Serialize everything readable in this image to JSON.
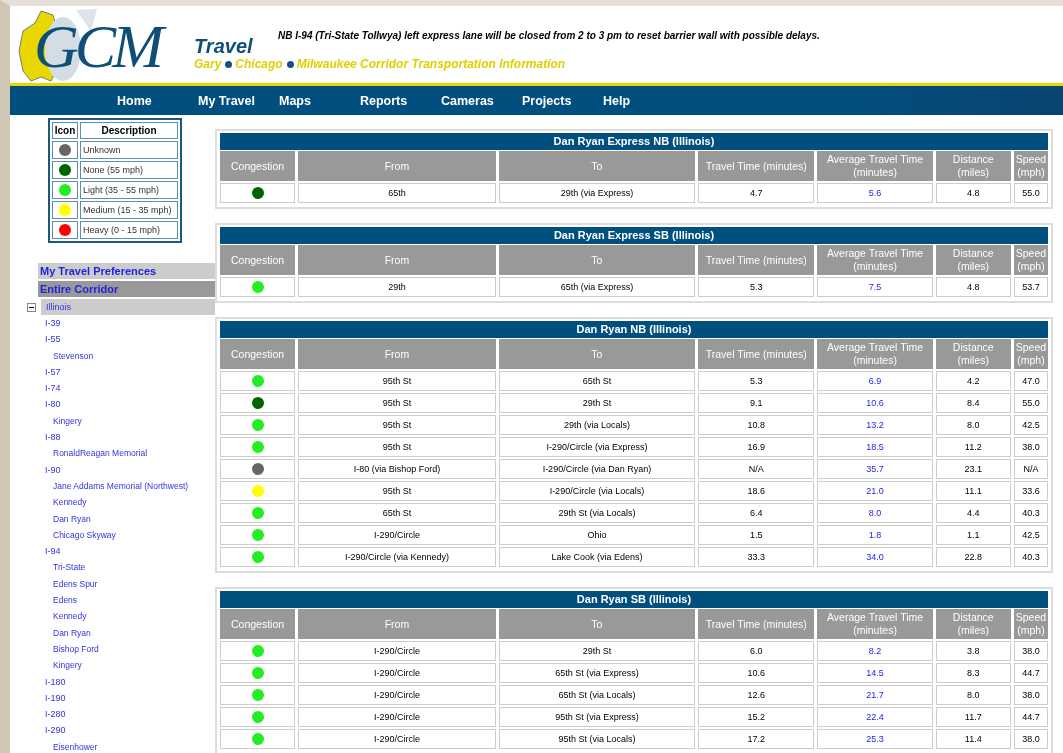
{
  "header": {
    "logo_text": "GCM",
    "brand": "Travel",
    "tagline": [
      "Gary",
      "Chicago",
      "Milwaukee Corridor Transportation Information"
    ],
    "alert": "NB I-94 (Tri-State Tollwya) left express lane will be closed from 2 to 3 pm to reset barrier wall with possible delays."
  },
  "nav": [
    "Home",
    "My Travel",
    "Maps",
    "Reports",
    "Cameras",
    "Projects",
    "Help"
  ],
  "legend": {
    "columns": [
      "Icon",
      "Description"
    ],
    "items": [
      {
        "color": "#666666",
        "label": "Unknown"
      },
      {
        "color": "#006400",
        "label": "None (55 mph)"
      },
      {
        "color": "#22ee22",
        "label": "Light (35 - 55 mph)"
      },
      {
        "color": "#ffff00",
        "label": "Medium (15 - 35 mph)"
      },
      {
        "color": "#ff0000",
        "label": "Heavy (0 - 15 mph)"
      }
    ]
  },
  "menu": [
    {
      "label": "My Travel Preferences",
      "selected": false
    },
    {
      "label": "Entire Corridor",
      "selected": true
    }
  ],
  "tree": [
    {
      "label": "Illinois",
      "expanded": true,
      "selected": true,
      "children": [
        {
          "label": "I-39",
          "selected": false
        },
        {
          "label": "I-55",
          "selected": false,
          "children": [
            {
              "label": "Stevenson",
              "selected": false
            }
          ]
        },
        {
          "label": "I-57",
          "selected": false
        },
        {
          "label": "I-74",
          "selected": false
        },
        {
          "label": "I-80",
          "selected": false,
          "children": [
            {
              "label": "Kingery",
              "selected": false
            }
          ]
        },
        {
          "label": "I-88",
          "selected": false,
          "children": [
            {
              "label": "RonaldReagan Memorial",
              "selected": false
            }
          ]
        },
        {
          "label": "I-90",
          "selected": false,
          "children": [
            {
              "label": "Jane Addams Memorial (Northwest)",
              "selected": false
            },
            {
              "label": "Kennedy",
              "selected": false
            },
            {
              "label": "Dan Ryan",
              "selected": false
            },
            {
              "label": "Chicago Skyway",
              "selected": false
            }
          ]
        },
        {
          "label": "I-94",
          "selected": false,
          "children": [
            {
              "label": "Tri-State",
              "selected": false
            },
            {
              "label": "Edens Spur",
              "selected": false
            },
            {
              "label": "Edens",
              "selected": false
            },
            {
              "label": "Kennedy",
              "selected": false
            },
            {
              "label": "Dan Ryan",
              "selected": false
            },
            {
              "label": "Bishop Ford",
              "selected": false
            },
            {
              "label": "Kingery",
              "selected": false
            }
          ]
        },
        {
          "label": "I-180",
          "selected": false
        },
        {
          "label": "I-190",
          "selected": false
        },
        {
          "label": "I-280",
          "selected": false
        },
        {
          "label": "I-290",
          "selected": false,
          "children": [
            {
              "label": "Eisenhower",
              "selected": false
            }
          ]
        }
      ]
    }
  ],
  "tables": [
    {
      "title": "Dan Ryan Express NB (Illinois)",
      "columns": [
        "Congestion",
        "From",
        "To",
        "Travel Time (minutes)",
        "Average Travel Time (minutes)",
        "Distance (miles)",
        "Speed (mph)"
      ],
      "rows": [
        {
          "color": "#006400",
          "from": "65th",
          "to": "29th (via Express)",
          "travel": "4.7",
          "average": "5.6",
          "distance": "4.8",
          "speed": "55.0"
        }
      ]
    },
    {
      "title": "Dan Ryan Express SB (Illinois)",
      "columns": [
        "Congestion",
        "From",
        "To",
        "Travel Time (minutes)",
        "Average Travel Time (minutes)",
        "Distance (miles)",
        "Speed (mph)"
      ],
      "rows": [
        {
          "color": "#22ee22",
          "from": "29th",
          "to": "65th (via Express)",
          "travel": "5.3",
          "average": "7.5",
          "distance": "4.8",
          "speed": "53.7"
        }
      ]
    },
    {
      "title": "Dan Ryan NB (Illinois)",
      "columns": [
        "Congestion",
        "From",
        "To",
        "Travel Time (minutes)",
        "Average Travel Time (minutes)",
        "Distance (miles)",
        "Speed (mph)"
      ],
      "rows": [
        {
          "color": "#22ee22",
          "from": "95th St",
          "to": "65th St",
          "travel": "5.3",
          "average": "6.9",
          "distance": "4.2",
          "speed": "47.0"
        },
        {
          "color": "#006400",
          "from": "95th St",
          "to": "29th St",
          "travel": "9.1",
          "average": "10.6",
          "distance": "8.4",
          "speed": "55.0"
        },
        {
          "color": "#22ee22",
          "from": "95th St",
          "to": "29th (via Locals)",
          "travel": "10.8",
          "average": "13.2",
          "distance": "8.0",
          "speed": "42.5"
        },
        {
          "color": "#22ee22",
          "from": "95th St",
          "to": "I-290/Circle (via Express)",
          "travel": "16.9",
          "average": "18.5",
          "distance": "11.2",
          "speed": "38.0"
        },
        {
          "color": "#666666",
          "from": "I-80 (via Bishop Ford)",
          "to": "I-290/Circle (via Dan Ryan)",
          "travel": "N/A",
          "average": "35.7",
          "distance": "23.1",
          "speed": "N/A"
        },
        {
          "color": "#ffff00",
          "from": "95th St",
          "to": "I-290/Circle (via Locals)",
          "travel": "18.6",
          "average": "21.0",
          "distance": "11.1",
          "speed": "33.6"
        },
        {
          "color": "#22ee22",
          "from": "65th St",
          "to": "29th St (via Locals)",
          "travel": "6.4",
          "average": "8.0",
          "distance": "4.4",
          "speed": "40.3"
        },
        {
          "color": "#22ee22",
          "from": "I-290/Circle",
          "to": "Ohio",
          "travel": "1.5",
          "average": "1.8",
          "distance": "1.1",
          "speed": "42.5"
        },
        {
          "color": "#22ee22",
          "from": "I-290/Circle (via Kennedy)",
          "to": "Lake Cook (via Edens)",
          "travel": "33.3",
          "average": "34.0",
          "distance": "22.8",
          "speed": "40.3"
        }
      ]
    },
    {
      "title": "Dan Ryan SB (Illinois)",
      "columns": [
        "Congestion",
        "From",
        "To",
        "Travel Time (minutes)",
        "Average Travel Time (minutes)",
        "Distance (miles)",
        "Speed (mph)"
      ],
      "rows": [
        {
          "color": "#22ee22",
          "from": "I-290/Circle",
          "to": "29th St",
          "travel": "6.0",
          "average": "8.2",
          "distance": "3.8",
          "speed": "38.0"
        },
        {
          "color": "#22ee22",
          "from": "I-290/Circle",
          "to": "65th St (via Express)",
          "travel": "10.6",
          "average": "14.5",
          "distance": "8.3",
          "speed": "44.7"
        },
        {
          "color": "#22ee22",
          "from": "I-290/Circle",
          "to": "65th St (via Locals)",
          "travel": "12.6",
          "average": "21.7",
          "distance": "8.0",
          "speed": "38.0"
        },
        {
          "color": "#22ee22",
          "from": "I-290/Circle",
          "to": "95th St (via Express)",
          "travel": "15.2",
          "average": "22.4",
          "distance": "11.7",
          "speed": "44.7"
        },
        {
          "color": "#22ee22",
          "from": "I-290/Circle",
          "to": "95th St (via Locals)",
          "travel": "17.2",
          "average": "25.3",
          "distance": "11.4",
          "speed": "38.0"
        }
      ]
    }
  ]
}
